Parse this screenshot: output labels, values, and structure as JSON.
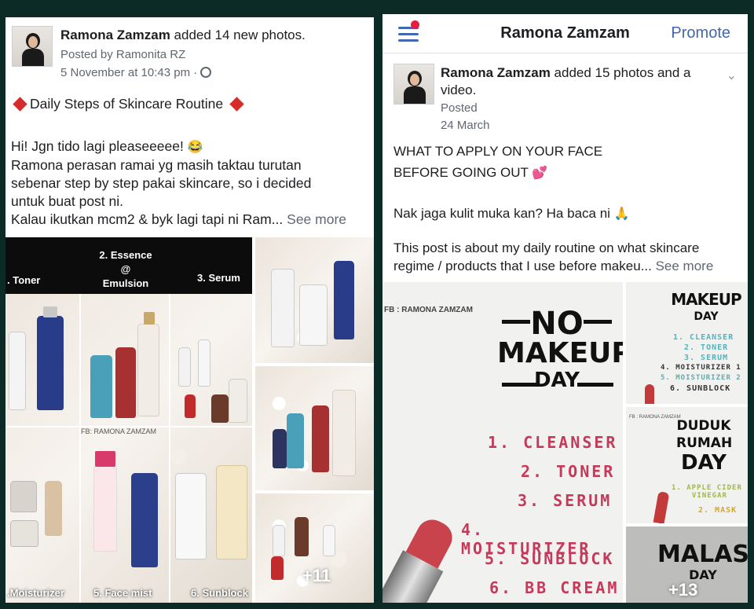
{
  "left_post": {
    "author": "Ramona Zamzam",
    "action": " added 14 new photos.",
    "posted_by": "Posted by Ramonita RZ",
    "timestamp": "5 November at 10:43 pm",
    "privacy_separator": "·",
    "headline": "Daily Steps of Skincare Routine",
    "line1": "Hi! Jgn tido lagi pleaseeeee!",
    "line1_emoji": "😂",
    "line2": "Ramona perasan ramai yg masih taktau turutan",
    "line3": "sebenar step by step pakai skincare, so i decided",
    "line4": "untuk buat post ni.",
    "line5": "Kalau ikutkan mcm2 & byk lagi tapi ni Ram...",
    "see_more": "See more",
    "collage": {
      "label_toner": ". Toner",
      "label_essence": "2. Essence",
      "label_at": "@",
      "label_emulsion": "Emulsion",
      "label_serum": "3. Serum",
      "watermark": "FB: RAMONA ZAMZAM",
      "label_moisturizer": ".Moisturizer",
      "label_face_mist": "5. Face mist",
      "label_sunblock": "6. Sunblock"
    },
    "more_photos": "+11"
  },
  "right_post": {
    "nav_title": "Ramona Zamzam",
    "promote": "Promote",
    "author": "Ramona Zamzam",
    "action": " added 15 photos and a",
    "action_line2": "video.",
    "posted": "Posted",
    "date": "24 March",
    "line1": "WHAT TO APPLY ON YOUR FACE",
    "line2": "BEFORE GOING OUT",
    "line2_emoji": "💕",
    "line3": "Nak jaga kulit muka kan? Ha baca ni",
    "line3_emoji": "🙏",
    "line4": "This post is about my daily routine on what skincare",
    "line5": "regime / products that I use before makeu...",
    "see_more": "See more",
    "poster_main": {
      "watermark": "FB : RAMONA ZAMZAM",
      "title_no": "NO",
      "title_makeup": "MAKEUP",
      "title_day": "DAY",
      "steps": [
        "1. CLEANSER",
        "2. TONER",
        "3. SERUM",
        "4. MOISTURIZER",
        "5. SUNBLOCK",
        "6. BB CREAM"
      ]
    },
    "poster_makeup": {
      "title_makeup": "MAKEUP",
      "title_day": "DAY",
      "steps": [
        "1. CLEANSER",
        "2. TONER",
        "3. SERUM",
        "4. MOISTURIZER 1",
        "5. MOISTURIZER 2",
        "6. SUNBLOCK"
      ]
    },
    "poster_duduk": {
      "watermark": "FB : RAMONA ZAMZAM",
      "title_duduk": "DUDUK",
      "title_rumah": "RUMAH",
      "title_day": "DAY",
      "step1": "1. APPLE CIDER",
      "step1b": "VINEGAR",
      "step2": "2. MASK"
    },
    "poster_malas": {
      "title_malas": "MALAS",
      "title_day": "DAY"
    },
    "more_photos": "+13"
  }
}
